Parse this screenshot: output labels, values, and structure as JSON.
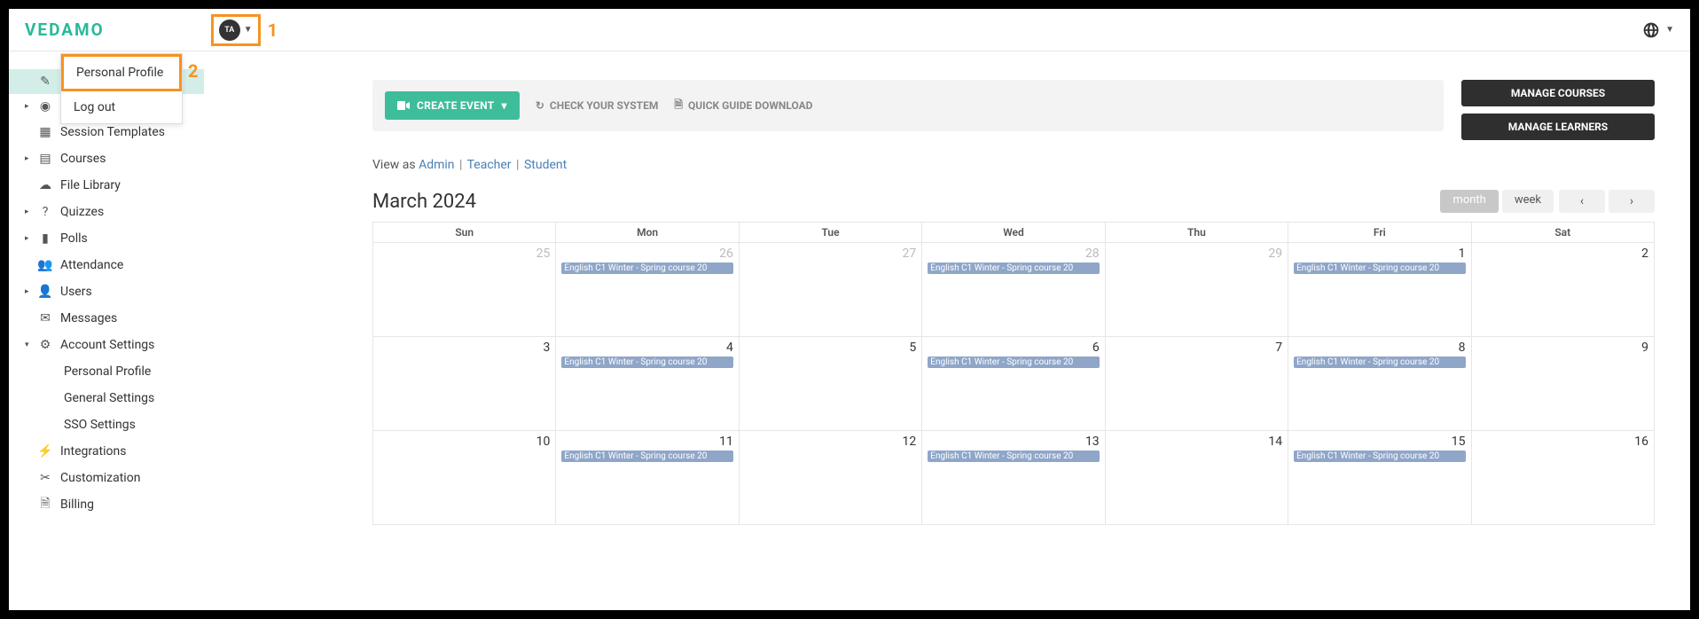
{
  "header": {
    "logo": "VEDAMO",
    "avatar_initials": "TA",
    "annotation1": "1",
    "annotation2": "2"
  },
  "profile_menu": {
    "items": [
      "Personal Profile",
      "Log out"
    ]
  },
  "sidebar": {
    "items": [
      {
        "label": "",
        "icon": "pencil",
        "expandable": false,
        "active": true
      },
      {
        "label": "",
        "icon": "play",
        "expandable": true
      },
      {
        "label": "Session Templates",
        "icon": "template",
        "expandable": false
      },
      {
        "label": "Courses",
        "icon": "book",
        "expandable": true
      },
      {
        "label": "File Library",
        "icon": "cloud",
        "expandable": false
      },
      {
        "label": "Quizzes",
        "icon": "question",
        "expandable": true
      },
      {
        "label": "Polls",
        "icon": "chart",
        "expandable": true
      },
      {
        "label": "Attendance",
        "icon": "people",
        "expandable": false
      },
      {
        "label": "Users",
        "icon": "users",
        "expandable": true
      },
      {
        "label": "Messages",
        "icon": "mail",
        "expandable": false
      },
      {
        "label": "Account Settings",
        "icon": "gear",
        "expandable": true,
        "expanded": true
      },
      {
        "label": "Integrations",
        "icon": "plug",
        "expandable": false
      },
      {
        "label": "Customization",
        "icon": "tools",
        "expandable": false
      },
      {
        "label": "Billing",
        "icon": "doc",
        "expandable": false
      }
    ],
    "settings_sub": [
      "Personal Profile",
      "General Settings",
      "SSO Settings"
    ]
  },
  "toolbar": {
    "create_label": "CREATE EVENT",
    "check_label": "CHECK YOUR SYSTEM",
    "guide_label": "QUICK GUIDE DOWNLOAD"
  },
  "right_buttons": {
    "manage_courses": "MANAGE COURSES",
    "manage_learners": "MANAGE LEARNERS"
  },
  "view_as": {
    "prefix": "View as ",
    "admin": "Admin",
    "teacher": "Teacher",
    "student": "Student"
  },
  "calendar": {
    "title": "March 2024",
    "view_month": "month",
    "view_week": "week",
    "event_label": "English C1 Winter - Spring course 20",
    "days": [
      "Sun",
      "Mon",
      "Tue",
      "Wed",
      "Thu",
      "Fri",
      "Sat"
    ],
    "rows": [
      [
        {
          "num": "25",
          "dim": true
        },
        {
          "num": "26",
          "dim": true,
          "event": true
        },
        {
          "num": "27",
          "dim": true
        },
        {
          "num": "28",
          "dim": true,
          "event": true
        },
        {
          "num": "29",
          "dim": true
        },
        {
          "num": "1",
          "event": true
        },
        {
          "num": "2"
        }
      ],
      [
        {
          "num": "3"
        },
        {
          "num": "4",
          "event": true
        },
        {
          "num": "5"
        },
        {
          "num": "6",
          "event": true
        },
        {
          "num": "7"
        },
        {
          "num": "8",
          "event": true
        },
        {
          "num": "9"
        }
      ],
      [
        {
          "num": "10"
        },
        {
          "num": "11",
          "event": true
        },
        {
          "num": "12"
        },
        {
          "num": "13",
          "event": true
        },
        {
          "num": "14"
        },
        {
          "num": "15",
          "event": true
        },
        {
          "num": "16"
        }
      ]
    ]
  }
}
